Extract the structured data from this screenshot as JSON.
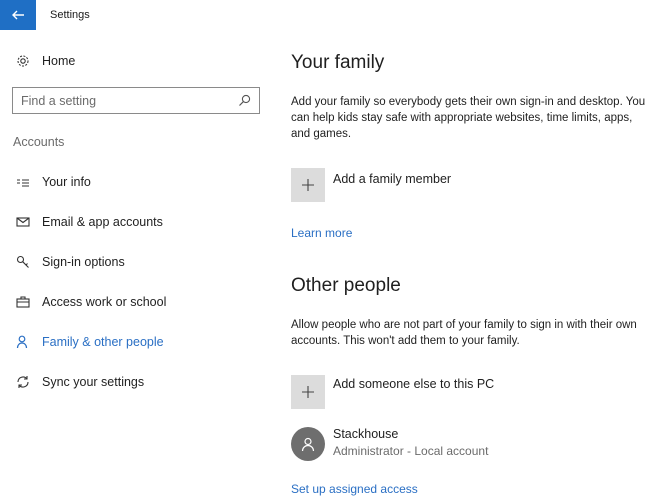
{
  "window": {
    "title": "Settings"
  },
  "sidebar": {
    "home_label": "Home",
    "search": {
      "placeholder": "Find a setting"
    },
    "section_label": "Accounts",
    "items": [
      {
        "label": "Your info",
        "icon": "user-info-icon"
      },
      {
        "label": "Email & app accounts",
        "icon": "mail-icon"
      },
      {
        "label": "Sign-in options",
        "icon": "key-icon"
      },
      {
        "label": "Access work or school",
        "icon": "briefcase-icon"
      },
      {
        "label": "Family & other people",
        "icon": "person-icon",
        "active": true
      },
      {
        "label": "Sync your settings",
        "icon": "sync-icon"
      }
    ]
  },
  "main": {
    "family": {
      "heading": "Your family",
      "description": "Add your family so everybody gets their own sign-in and desktop. You can help kids stay safe with appropriate websites, time limits, apps, and games.",
      "add_label": "Add a family member",
      "learn_more": "Learn more"
    },
    "others": {
      "heading": "Other people",
      "description": "Allow people who are not part of your family to sign in with their own accounts. This won't add them to your family.",
      "add_label": "Add someone else to this PC",
      "user": {
        "name": "Stackhouse",
        "role": "Administrator - Local account"
      },
      "assigned_access": "Set up assigned access"
    }
  },
  "colors": {
    "accent": "#2a6fc4",
    "back_button": "#1f6fc5",
    "tile": "#dcdcdc"
  }
}
